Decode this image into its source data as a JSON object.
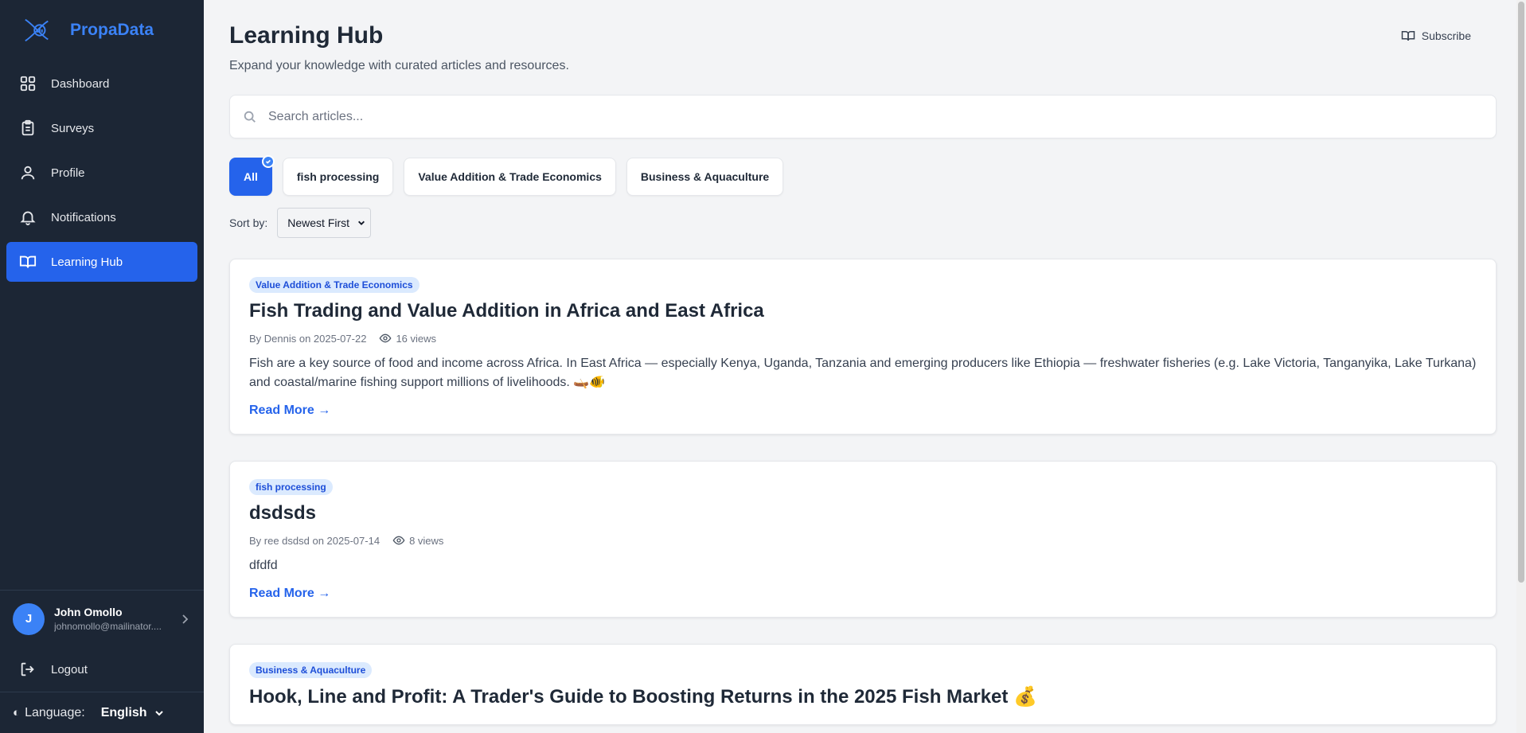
{
  "brand": {
    "name": "PropaData",
    "logo_icon": "fish-chart-logo-icon"
  },
  "sidebar": {
    "items": [
      {
        "label": "Dashboard",
        "icon": "grid-icon",
        "active": false
      },
      {
        "label": "Surveys",
        "icon": "clipboard-icon",
        "active": false
      },
      {
        "label": "Profile",
        "icon": "user-icon",
        "active": false
      },
      {
        "label": "Notifications",
        "icon": "bell-icon",
        "active": false
      },
      {
        "label": "Learning Hub",
        "icon": "book-open-icon",
        "active": true
      }
    ],
    "user": {
      "initial": "J",
      "name": "John Omollo",
      "email": "johnomollo@mailinator...."
    },
    "logout_label": "Logout",
    "language": {
      "label": "Language:",
      "value": "English"
    }
  },
  "header": {
    "title": "Learning Hub",
    "subtitle": "Expand your knowledge with curated articles and resources.",
    "subscribe_label": "Subscribe"
  },
  "search": {
    "placeholder": "Search articles..."
  },
  "filters": [
    {
      "label": "All",
      "active": true
    },
    {
      "label": "fish processing",
      "active": false
    },
    {
      "label": "Value Addition & Trade Economics",
      "active": false
    },
    {
      "label": "Business & Aquaculture",
      "active": false
    }
  ],
  "sort": {
    "label": "Sort by:",
    "value": "Newest First"
  },
  "articles": [
    {
      "tag": "Value Addition & Trade Economics",
      "title": "Fish Trading and Value Addition in Africa and East Africa",
      "meta": "By Dennis on 2025-07-22",
      "views": "16 views",
      "excerpt": "Fish are a key source of food and income across Africa. In East Africa — especially Kenya, Uganda, Tanzania and emerging producers like Ethiopia — freshwater fisheries (e.g. Lake Victoria, Tanganyika, Lake Turkana) and coastal/marine fishing support millions of livelihoods. 🛶🐠",
      "read_more": "Read More →"
    },
    {
      "tag": "fish processing",
      "title": "dsdsds",
      "meta": "By ree dsdsd on 2025-07-14",
      "views": "8 views",
      "excerpt": "dfdfd",
      "read_more": "Read More →"
    },
    {
      "tag": "Business & Aquaculture",
      "title": "Hook, Line and Profit: A Trader's Guide to Boosting Returns in the 2025 Fish Market 💰",
      "meta": "",
      "views": "",
      "excerpt": "",
      "read_more": ""
    }
  ],
  "colors": {
    "sidebar_bg": "#1c2635",
    "accent": "#2563eb",
    "brand": "#3b82f6"
  }
}
